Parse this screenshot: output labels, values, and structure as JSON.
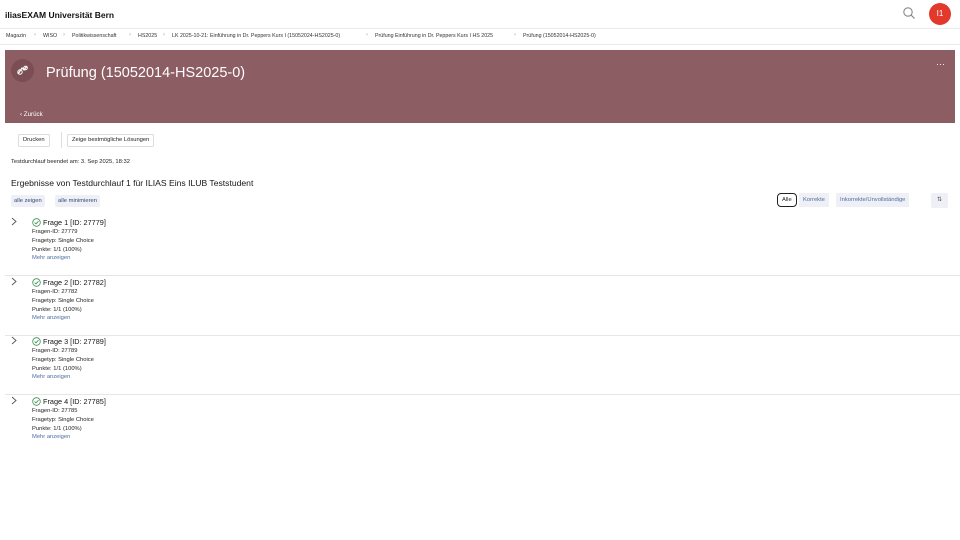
{
  "app": {
    "title": "iliasEXAM Universität Bern",
    "avatar_initials": "I1"
  },
  "breadcrumb": [
    "Magazin",
    "WISO",
    "Politikwissenschaft",
    "HS2025",
    "LK 2025-10-21: Einführung in Dr. Peppers Kurs I (15052024-HS2025-0)",
    "Prüfung Einführung in Dr. Peppers Kurs I HS 2025",
    "Prüfung (15052014-HS2025-0)"
  ],
  "header": {
    "title": "Prüfung (15052014-HS2025-0)",
    "back_label": "Zurück",
    "more_label": "···",
    "bg_color": "#8c5d62"
  },
  "toolbar": {
    "print_label": "Drucken",
    "solutions_label": "Zeige bestmögliche Lösungen"
  },
  "finished_text": "Testdurchlauf beendet am: 3. Sep 2025, 18:32",
  "results_title": "Ergebnisse von Testdurchlauf 1 für ILIAS Eins ILUB Teststudent",
  "controls": {
    "show_all": "alle zeigen",
    "minimize_all": "alle minimieren"
  },
  "filters": {
    "all": "Alle",
    "correct": "Korrekte",
    "incorrect": "Inkorrekte/Unvollständige"
  },
  "questions": [
    {
      "title": "Frage 1 [ID: 27779]",
      "id_line": "Fragen-ID:  27779",
      "type_line": "Fragetyp:  Single Choice",
      "points_line": "Punkte:  1/1 (100%)",
      "more": "Mehr anzeigen"
    },
    {
      "title": "Frage 2 [ID: 27782]",
      "id_line": "Fragen-ID:  27782",
      "type_line": "Fragetyp:  Single Choice",
      "points_line": "Punkte:  1/1 (100%)",
      "more": "Mehr anzeigen"
    },
    {
      "title": "Frage 3 [ID: 27789]",
      "id_line": "Fragen-ID:  27789",
      "type_line": "Fragetyp:  Single Choice",
      "points_line": "Punkte:  1/1 (100%)",
      "more": "Mehr anzeigen"
    },
    {
      "title": "Frage 4 [ID: 27785]",
      "id_line": "Fragen-ID:  27785",
      "type_line": "Fragetyp:  Single Choice",
      "points_line": "Punkte:  1/1 (100%)",
      "more": "Mehr anzeigen"
    }
  ],
  "colors": {
    "accent_red": "#e3392c",
    "link_blue": "#4b6ea1",
    "success_green": "#3f8f55"
  }
}
